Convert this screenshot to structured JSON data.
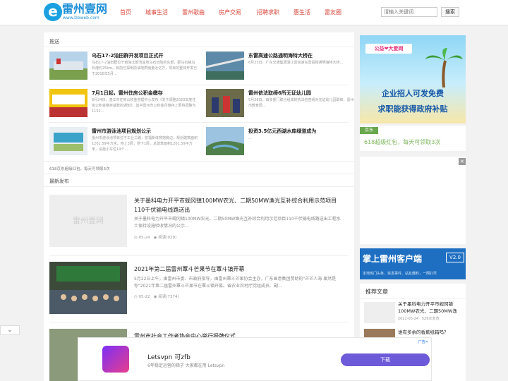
{
  "header": {
    "logo_e": "e",
    "logo_name": "雷州壹网",
    "logo_url": "www.lzeweb.com",
    "nav": [
      "首页",
      "城事生活",
      "雷州歌曲",
      "房产交易",
      "招聘求职",
      "惠生活",
      "雷友圈"
    ],
    "search_placeholder": "请输入关键词",
    "search_button": "搜索"
  },
  "recommend": {
    "title": "推送",
    "items": [
      {
        "title": "乌石17-2油田群开发项目正式开",
        "desc": "乌石17-2油田群位于南海北部湾盆地乌石凹陷的东部，距乌石镇乌石港约25km。目前已探明原油地质储量近亿方，项目的整体开发已于2016年5月..."
      },
      {
        "title": "东雷高速公路通明海特大桥在",
        "desc": "6月23日，广东交通集团湛江雷高速东雷段跨通明海特大桥..."
      },
      {
        "title": "7月1日起，雷州住房公积金缴存",
        "desc": "6月24日，湛江市住房公积金管理中心发布《关于调整2020年度住房公积金缴存基数的通知》，其中雷州市公积金月缴存上限将调整为1152..."
      },
      {
        "title": "雷州依法取缔6所无证幼儿园",
        "desc": "5月28日，由多部门联合组成的执法检查组对无证幼儿园取缔，雷州市教育局..."
      },
      {
        "title": "雷州市游泳池项目规划公示",
        "desc": "雷州市游泳池项目位于工业三路，宏福新体育馆旁边，规划建筑面积1201.59平方米，地上3层，地下1层，总建筑面积1201.59平方米，设施小车位14个..."
      },
      {
        "title": "投资3.5亿元西湖水库绿道成为",
        "desc": "..."
      }
    ],
    "note": "618京东超级红包，每天可领取3次"
  },
  "latest": {
    "title": "最新发布",
    "articles": [
      {
        "title": "关于墨科电力开平市蚬冈镇100MW农光、二期50MW渔光互补综合利用示范项目110千伏输电线路送出",
        "desc": "关于墨科电力开平市蚬冈镇100MW农光、二期50MW渔光互补综合利用示范项目110千伏输电线路送出工程水土保持设施验收情况的公示...",
        "date": "05-24",
        "views": "阅读(929)",
        "placeholder": "雷州壹网"
      },
      {
        "title": "2021年第二届雷州覃斗芒果节在覃斗镇开幕",
        "desc": "5月22日上午，由雷州市委、市政府指导，由雷州覃斗芒果协会主办，广东画意集团赞助的\"芒芒人海 果然是你\"2021年第二届雷州覃斗芒果节在覃斗镇开幕。省农业农村厅党组成员、副...",
        "date": "05-22",
        "views": "阅读(7374)"
      },
      {
        "title": "雷州市社会工作者协会中心举行授牌仪式",
        "desc": "",
        "date": "",
        "views": ""
      }
    ]
  },
  "sidebar": {
    "ad1": {
      "brand": "公益❤大爱网",
      "line1": "企业招人可发免费",
      "line2": "求职能获得政府补贴"
    },
    "jd": {
      "tag": "京东",
      "text": "618超级红包，每天可领取3次"
    },
    "ad2_close": "×",
    "app": {
      "title": "掌上雷州客户端",
      "version": "V2.0",
      "sub": "本地热门头条、突发事件、站友爆料，一网打尽"
    },
    "recommend_title": "推荐文章",
    "recommend_items": [
      {
        "title": "关于墨科电力开平市蚬冈镇100MW农光、二期50MW渔",
        "date": "2022-05-24",
        "views": "529次浏览"
      },
      {
        "title": "谁有多余的香蕉纸箱吗？",
        "date": "",
        "views": ""
      }
    ]
  },
  "collapse_icon": "⌄",
  "bottom_ad": {
    "title": "Letsvpn 可zfb",
    "desc": "6年稳定运营的梯子 大家都在用 Letsvpn",
    "button": "下载",
    "mark": "广告✕"
  }
}
